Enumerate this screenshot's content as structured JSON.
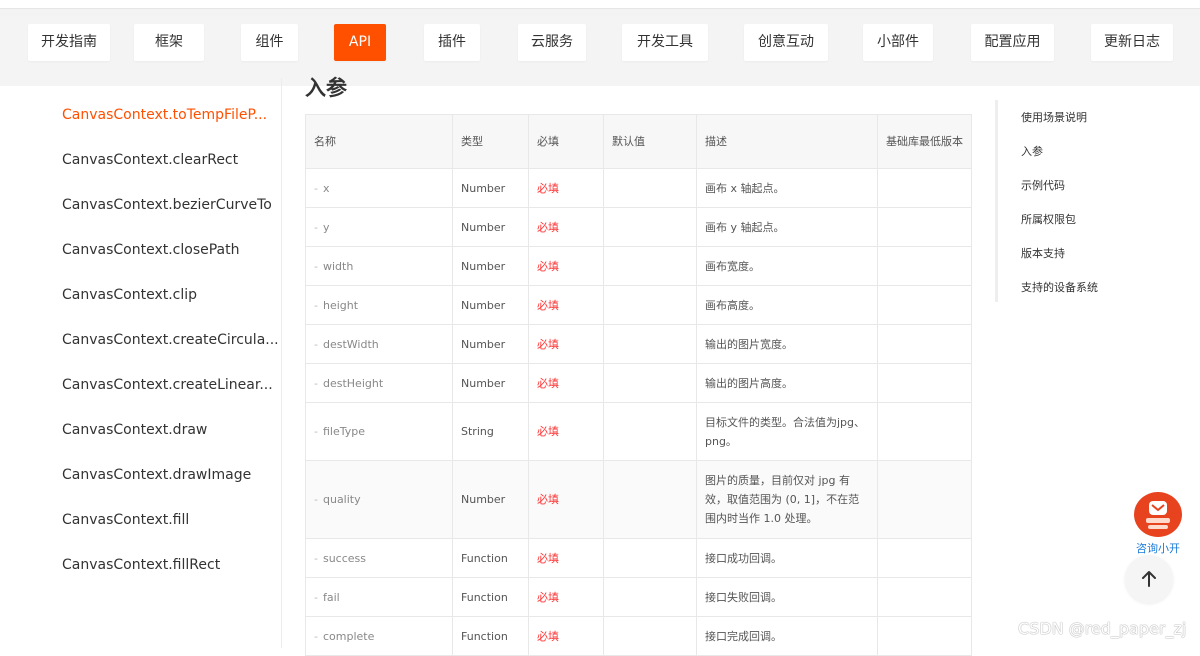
{
  "nav": {
    "items": [
      "开发指南",
      "框架",
      "组件",
      "API",
      "插件",
      "云服务",
      "开发工具",
      "创意互动",
      "小部件",
      "配置应用",
      "更新日志"
    ],
    "active": "API"
  },
  "sidebar": {
    "items": [
      "CanvasContext.toTempFileP...",
      "CanvasContext.clearRect",
      "CanvasContext.bezierCurveTo",
      "CanvasContext.closePath",
      "CanvasContext.clip",
      "CanvasContext.createCircula...",
      "CanvasContext.createLinear...",
      "CanvasContext.draw",
      "CanvasContext.drawImage",
      "CanvasContext.fill",
      "CanvasContext.fillRect"
    ],
    "active_index": 0
  },
  "main": {
    "heading": "入参",
    "table": {
      "headers": [
        "名称",
        "类型",
        "必填",
        "默认值",
        "描述",
        "基础库最低版本"
      ],
      "rows": [
        {
          "name": "x",
          "type": "Number",
          "required": "必填",
          "default": "",
          "desc": "画布 x 轴起点。",
          "version": ""
        },
        {
          "name": "y",
          "type": "Number",
          "required": "必填",
          "default": "",
          "desc": "画布 y 轴起点。",
          "version": ""
        },
        {
          "name": "width",
          "type": "Number",
          "required": "必填",
          "default": "",
          "desc": "画布宽度。",
          "version": ""
        },
        {
          "name": "height",
          "type": "Number",
          "required": "必填",
          "default": "",
          "desc": "画布高度。",
          "version": ""
        },
        {
          "name": "destWidth",
          "type": "Number",
          "required": "必填",
          "default": "",
          "desc": "输出的图片宽度。",
          "version": ""
        },
        {
          "name": "destHeight",
          "type": "Number",
          "required": "必填",
          "default": "",
          "desc": "输出的图片高度。",
          "version": ""
        },
        {
          "name": "fileType",
          "type": "String",
          "required": "必填",
          "default": "",
          "desc": "目标文件的类型。合法值为jpg、png。",
          "version": ""
        },
        {
          "name": "quality",
          "type": "Number",
          "required": "必填",
          "default": "",
          "desc": "图片的质量，目前仅对 jpg 有效，取值范围为 (0, 1]，不在范围内时当作 1.0 处理。",
          "version": ""
        },
        {
          "name": "success",
          "type": "Function",
          "required": "必填",
          "default": "",
          "desc": "接口成功回调。",
          "version": ""
        },
        {
          "name": "fail",
          "type": "Function",
          "required": "必填",
          "default": "",
          "desc": "接口失败回调。",
          "version": ""
        },
        {
          "name": "complete",
          "type": "Function",
          "required": "必填",
          "default": "",
          "desc": "接口完成回调。",
          "version": ""
        }
      ]
    }
  },
  "toc": {
    "items": [
      "使用场景说明",
      "入参",
      "示例代码",
      "所属权限包",
      "版本支持",
      "支持的设备系统"
    ]
  },
  "floating": {
    "consult_label": "咨询小开",
    "back_to_top_icon": "arrow-up-icon"
  },
  "watermark": "CSDN @red_paper_zj",
  "colors": {
    "accent": "#ff5000",
    "required": "#ff3333",
    "link": "#1a7ad8"
  }
}
